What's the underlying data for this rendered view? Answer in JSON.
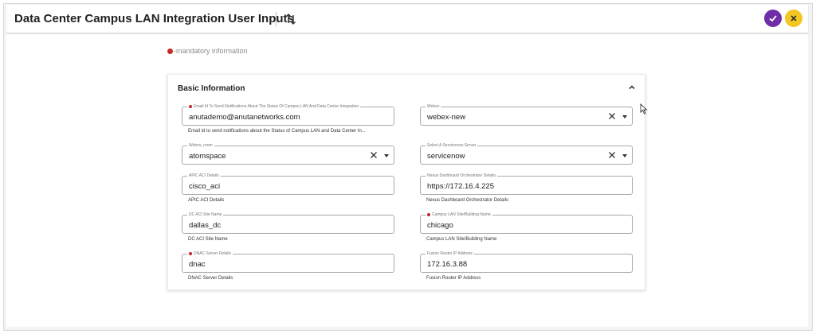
{
  "header": {
    "title": "Data Center Campus LAN Integration User Inputs",
    "sort_icon": "sort-arrows-icon",
    "confirm_icon": "check-icon",
    "cancel_icon": "close-icon",
    "colors": {
      "confirm": "#6f2da8",
      "cancel": "#f3c623",
      "required": "#c62828"
    }
  },
  "mandatory_note": "-mandatory information",
  "card": {
    "title": "Basic Information",
    "collapse_icon": "chevron-up-icon"
  },
  "fields": {
    "email": {
      "label": "Email Id To Send Notifications About The Status Of Campus LAN And Data Center Integration",
      "value": "anutademo@anutanetworks.com",
      "hint": "Email id to send notifications about the Status of Campus LAN and Data Center In..."
    },
    "webex": {
      "label": "Webex",
      "value": "webex-new"
    },
    "webex_room": {
      "label": "Webex_room",
      "value": "atomspace"
    },
    "servicenow": {
      "label": "Select A Servicenow Server",
      "value": "servicenow"
    },
    "apic": {
      "label": "APIC ACI Details",
      "value": "cisco_aci",
      "hint": "APIC ACI Details"
    },
    "ndo": {
      "label": "Nexus Dashboard Orchestrator Details",
      "value": "https://172.16.4.225",
      "hint": "Nexus Dashboard Orchestrator Details"
    },
    "dc_site": {
      "label": "DC ACI Site Name",
      "value": "dallas_dc",
      "hint": "DC ACI Site Name"
    },
    "campus_site": {
      "label": "Campus LAN Site/Building Name",
      "value": "chicago",
      "hint": "Campus LAN Site/Building Name"
    },
    "dnac": {
      "label": "DNAC Server Details",
      "value": "dnac",
      "hint": "DNAC Server Details"
    },
    "fusion": {
      "label": "Fusion Router IP Address",
      "value": "172.16.3.88",
      "hint": "Fusion Router IP Address"
    }
  }
}
